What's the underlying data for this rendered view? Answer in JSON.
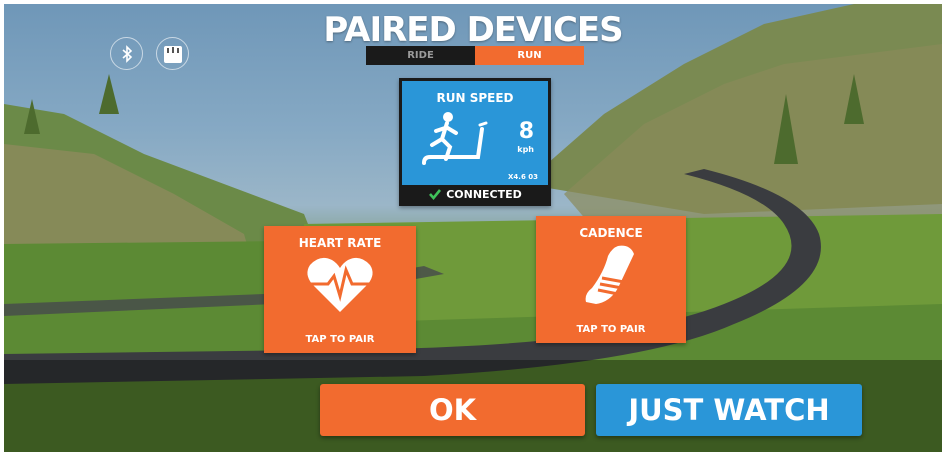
{
  "header": {
    "title": "PAIRED DEVICES"
  },
  "sport_toggle": {
    "ride_label": "RIDE",
    "run_label": "RUN",
    "selected": "RUN"
  },
  "icons": {
    "bluetooth": "bluetooth-icon",
    "ant": "ant-icon",
    "ant_label": "ANT"
  },
  "devices": {
    "run_speed": {
      "title": "RUN SPEED",
      "value": "8",
      "unit": "kph",
      "device_id": "X4.6 03",
      "status": "CONNECTED"
    },
    "heart_rate": {
      "title": "HEART RATE",
      "action": "TAP TO PAIR"
    },
    "cadence": {
      "title": "CADENCE",
      "action": "TAP TO PAIR"
    }
  },
  "buttons": {
    "ok": "OK",
    "just_watch": "JUST WATCH"
  },
  "colors": {
    "orange": "#f26b2f",
    "blue": "#2a96d8",
    "dark": "#1a1a1a"
  }
}
